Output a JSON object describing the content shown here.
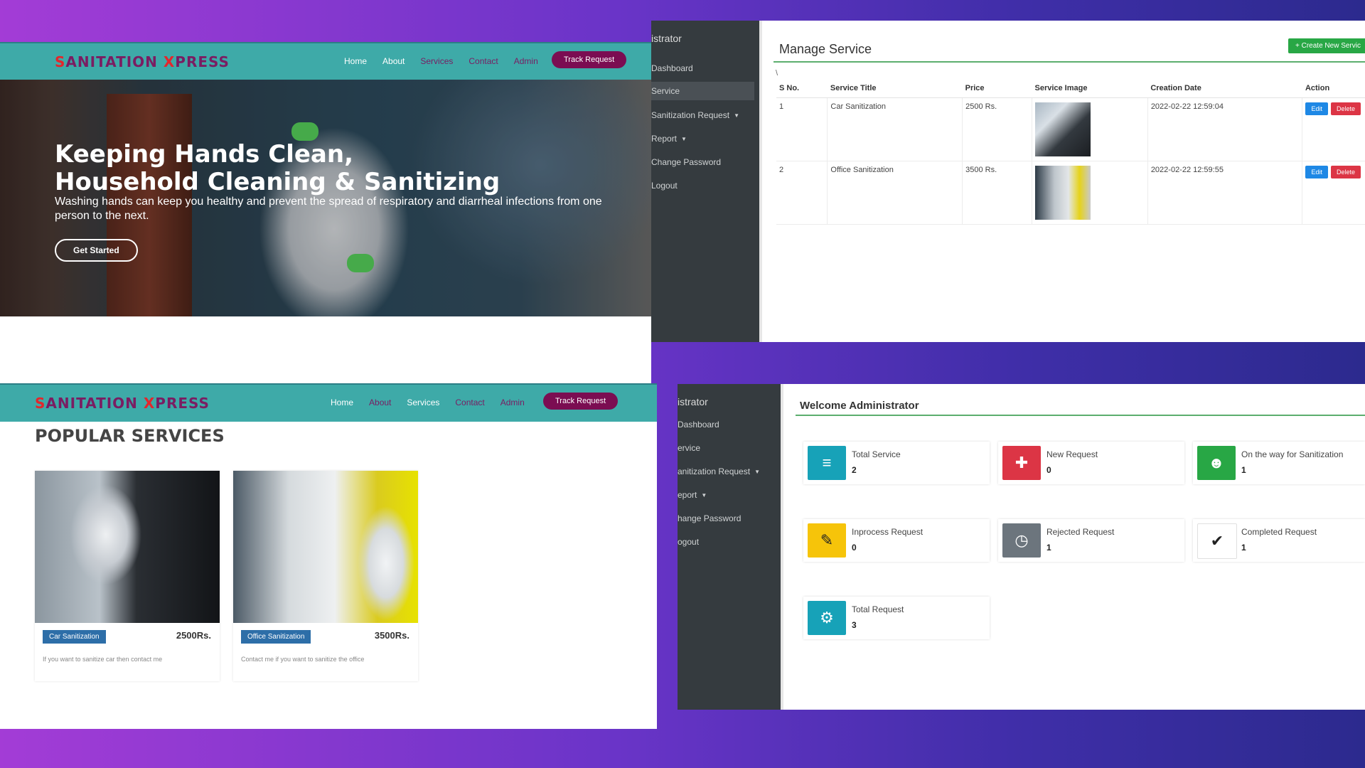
{
  "site_hero": {
    "brand_first": "S",
    "brand_mid": "ANITATION ",
    "brand_x": "X",
    "brand_last": "PRESS",
    "nav": [
      "Home",
      "About",
      "Services",
      "Contact",
      "Admin"
    ],
    "active_nav": "Home",
    "track_request": "Track Request",
    "headline_line1": "Keeping Hands Clean,",
    "headline_line2": "Household Cleaning & Sanitizing",
    "subtitle": "Washing hands can keep you healthy and prevent the spread of respiratory and diarrheal infections from one person to the next.",
    "cta": "Get Started"
  },
  "manage_service": {
    "sidebar_title": "istrator",
    "sidebar": [
      "Dashboard",
      "Service",
      "Sanitization Request",
      "Report",
      "Change Password",
      "Logout"
    ],
    "page_title": "Manage Service",
    "create_button": "+ Create New Servic",
    "stray_char": "\\",
    "columns": [
      "S No.",
      "Service Title",
      "Price",
      "Service Image",
      "Creation Date",
      "Action"
    ],
    "rows": [
      {
        "sno": "1",
        "title": "Car Sanitization",
        "price": "2500 Rs.",
        "date": "2022-02-22 12:59:04"
      },
      {
        "sno": "2",
        "title": "Office Sanitization",
        "price": "3500 Rs.",
        "date": "2022-02-22 12:59:55"
      }
    ],
    "edit_label": "Edit",
    "delete_label": "Delete"
  },
  "popular_services": {
    "active_nav": "Services",
    "title": "POPULAR SERVICES",
    "cards": [
      {
        "tag": "Car Sanitization",
        "price": "2500Rs.",
        "desc": "If you want to sanitize car then contact me"
      },
      {
        "tag": "Office Sanitization",
        "price": "3500Rs.",
        "desc": "Contact me if you want to sanitize the office"
      }
    ]
  },
  "dashboard": {
    "sidebar_title": "istrator",
    "sidebar": [
      "Dashboard",
      "ervice",
      "anitization Request",
      "eport",
      "hange Password",
      "ogout"
    ],
    "title": "Welcome Administrator",
    "tiles": [
      {
        "label": "Total Service",
        "value": "2",
        "color": "#17a2b8",
        "icon": "layers-icon"
      },
      {
        "label": "New Request",
        "value": "0",
        "color": "#dc3545",
        "icon": "user-plus-icon"
      },
      {
        "label": "On the way for Sanitization",
        "value": "1",
        "color": "#28a745",
        "icon": "users-icon"
      },
      {
        "label": "Inprocess Request",
        "value": "0",
        "color": "#f6c40a",
        "icon": "user-edit-icon"
      },
      {
        "label": "Rejected Request",
        "value": "1",
        "color": "#6c757d",
        "icon": "user-clock-icon"
      },
      {
        "label": "Completed Request",
        "value": "1",
        "color": "#ffffff",
        "icon": "user-check-icon"
      },
      {
        "label": "Total Request",
        "value": "3",
        "color": "#17a2b8",
        "icon": "user-cog-icon"
      }
    ]
  }
}
